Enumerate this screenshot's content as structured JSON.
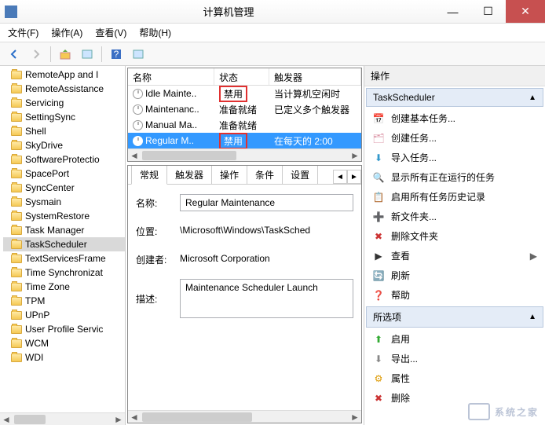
{
  "window": {
    "title": "计算机管理"
  },
  "menu": {
    "file": "文件(F)",
    "action": "操作(A)",
    "view": "查看(V)",
    "help": "帮助(H)"
  },
  "tree": {
    "items": [
      "RemoteApp and I",
      "RemoteAssistance",
      "Servicing",
      "SettingSync",
      "Shell",
      "SkyDrive",
      "SoftwareProtectio",
      "SpacePort",
      "SyncCenter",
      "Sysmain",
      "SystemRestore",
      "Task Manager",
      "TaskScheduler",
      "TextServicesFrame",
      "Time Synchronizat",
      "Time Zone",
      "TPM",
      "UPnP",
      "User Profile Servic",
      "WCM",
      "WDI"
    ],
    "selected_index": 12
  },
  "tasks": {
    "cols": {
      "name": "名称",
      "status": "状态",
      "trigger": "触发器"
    },
    "rows": [
      {
        "name": "Idle Mainte..",
        "status": "禁用",
        "trigger": "当计算机空闲时",
        "highlight_status": true
      },
      {
        "name": "Maintenanc..",
        "status": "准备就绪",
        "trigger": "已定义多个触发器"
      },
      {
        "name": "Manual Ma..",
        "status": "准备就绪",
        "trigger": ""
      },
      {
        "name": "Regular M..",
        "status": "禁用",
        "trigger": "在每天的 2:00",
        "highlight_status": true,
        "selected": true
      }
    ]
  },
  "tabs": {
    "general": "常规",
    "triggers": "触发器",
    "actions": "操作",
    "conditions": "条件",
    "settings": "设置"
  },
  "detail": {
    "name_label": "名称:",
    "name": "Regular Maintenance",
    "location_label": "位置:",
    "location": "\\Microsoft\\Windows\\TaskSched",
    "author_label": "创建者:",
    "author": "Microsoft Corporation",
    "desc_label": "描述:",
    "desc": "Maintenance Scheduler Launch"
  },
  "actions": {
    "header": "操作",
    "section1": "TaskScheduler",
    "items1": [
      "创建基本任务...",
      "创建任务...",
      "导入任务...",
      "显示所有正在运行的任务",
      "启用所有任务历史记录",
      "新文件夹...",
      "删除文件夹",
      "查看",
      "刷新",
      "帮助"
    ],
    "section2": "所选项",
    "items2": [
      "启用",
      "导出...",
      "属性",
      "删除"
    ]
  },
  "watermark": "系统之家"
}
